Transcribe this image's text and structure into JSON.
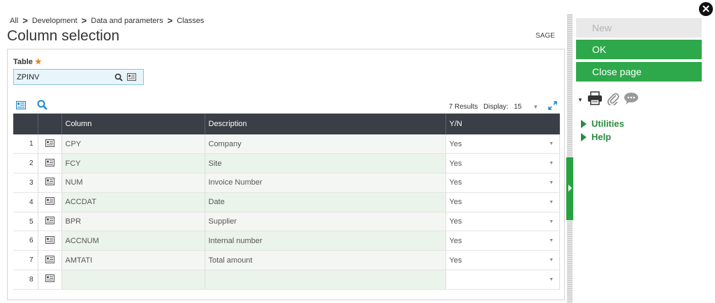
{
  "breadcrumb": [
    {
      "label": "All"
    },
    {
      "label": "Development"
    },
    {
      "label": "Data and parameters"
    },
    {
      "label": "Classes"
    }
  ],
  "page_title": "Column selection",
  "folder": "SAGE",
  "table_field": {
    "label": "Table",
    "value": "ZPINV"
  },
  "results": {
    "count_text": "7 Results",
    "display_label": "Display:",
    "display_value": "15"
  },
  "grid": {
    "headers": [
      "Column",
      "Description",
      "Y/N"
    ],
    "rows": [
      {
        "num": "1",
        "column": "CPY",
        "description": "Company",
        "yn": "Yes"
      },
      {
        "num": "2",
        "column": "FCY",
        "description": "Site",
        "yn": "Yes"
      },
      {
        "num": "3",
        "column": "NUM",
        "description": "Invoice Number",
        "yn": "Yes"
      },
      {
        "num": "4",
        "column": "ACCDAT",
        "description": "Date",
        "yn": "Yes"
      },
      {
        "num": "5",
        "column": "BPR",
        "description": "Supplier",
        "yn": "Yes"
      },
      {
        "num": "6",
        "column": "ACCNUM",
        "description": "Internal number",
        "yn": "Yes"
      },
      {
        "num": "7",
        "column": "AMTATI",
        "description": "Total amount",
        "yn": "Yes"
      },
      {
        "num": "8",
        "column": "",
        "description": "",
        "yn": ""
      }
    ]
  },
  "actions": {
    "new": "New",
    "ok": "OK",
    "close_page": "Close page"
  },
  "sections": {
    "utilities": "Utilities",
    "help": "Help"
  },
  "colors": {
    "accent_green": "#2da84a",
    "header_dark": "#3a3f47",
    "link_blue": "#1e87c7"
  },
  "icons": [
    "search-icon",
    "record-card-icon",
    "expand-icon",
    "print-icon",
    "paperclip-icon",
    "comment-icon",
    "close-icon"
  ]
}
